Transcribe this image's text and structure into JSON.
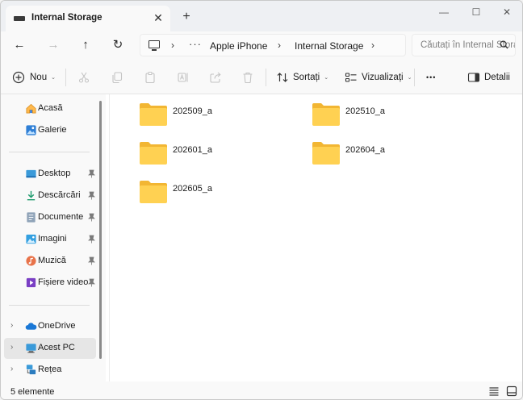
{
  "tab": {
    "title": "Internal Storage",
    "close": "✕",
    "new_tab": "+"
  },
  "window_controls": {
    "minimize": "—",
    "maximize": "☐",
    "close": "✕"
  },
  "nav": {
    "back": "←",
    "forward": "→",
    "up": "↑",
    "refresh": "↻"
  },
  "address": {
    "chevron": "›",
    "more": "···",
    "segments": [
      "Apple iPhone",
      "Internal Storage"
    ]
  },
  "search": {
    "placeholder": "Căutați în Internal Storage"
  },
  "toolbar": {
    "new_label": "Nou",
    "sort_label": "Sortați",
    "view_label": "Vizualizați",
    "more_label": "•••",
    "details_label": "Detalii",
    "caret": "⌄"
  },
  "sidebar": {
    "expand_glyph": "›",
    "quick": [
      {
        "label": "Acasă",
        "icon": "home-icon"
      },
      {
        "label": "Galerie",
        "icon": "gallery-icon"
      }
    ],
    "pinned": [
      {
        "label": "Desktop",
        "icon": "desktop-icon"
      },
      {
        "label": "Descărcări",
        "icon": "downloads-icon"
      },
      {
        "label": "Documente",
        "icon": "documents-icon"
      },
      {
        "label": "Imagini",
        "icon": "pictures-icon"
      },
      {
        "label": "Muzică",
        "icon": "music-icon"
      },
      {
        "label": "Fișiere video",
        "icon": "videos-icon"
      }
    ],
    "locations": [
      {
        "label": "OneDrive",
        "icon": "onedrive-icon"
      },
      {
        "label": "Acest PC",
        "icon": "this-pc-icon",
        "selected": true
      },
      {
        "label": "Rețea",
        "icon": "network-icon"
      }
    ]
  },
  "files": [
    {
      "name": "202509_a",
      "icon": "folder-icon"
    },
    {
      "name": "202510_a",
      "icon": "folder-icon"
    },
    {
      "name": "202601_a",
      "icon": "folder-icon"
    },
    {
      "name": "202604_a",
      "icon": "folder-icon"
    },
    {
      "name": "202605_a",
      "icon": "folder-icon"
    }
  ],
  "status": {
    "item_count": "5 elemente"
  },
  "colors": {
    "accent": "#0067c0",
    "folder_front": "#ffd152",
    "folder_back": "#f2b633",
    "selected": "#e6e6e6"
  }
}
